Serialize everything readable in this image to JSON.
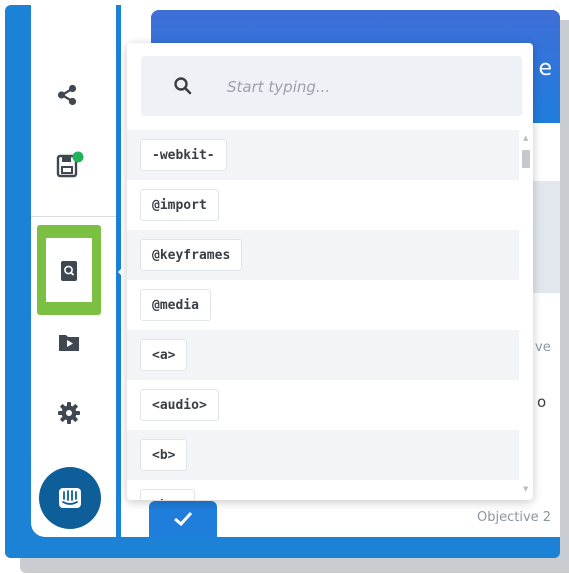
{
  "search": {
    "placeholder": "Start typing..."
  },
  "items": [
    "-webkit-",
    "@import",
    "@keyframes",
    "@media",
    "<a>",
    "<audio>",
    "<b>",
    "<br>"
  ],
  "background": {
    "header_letter": "e",
    "side_text_1": "ve",
    "side_text_2": "o",
    "footer_text": "Objective 2"
  },
  "sidebar": {
    "icons": [
      "share-icon",
      "save-icon",
      "reference-book-icon",
      "media-folder-icon",
      "gear-icon",
      "intercom-chat-icon"
    ],
    "save_status_color": "#21b35a",
    "highlight_color": "#7cc043"
  },
  "colors": {
    "accent": "#1b82d6",
    "chat_button": "#0e5f99"
  }
}
